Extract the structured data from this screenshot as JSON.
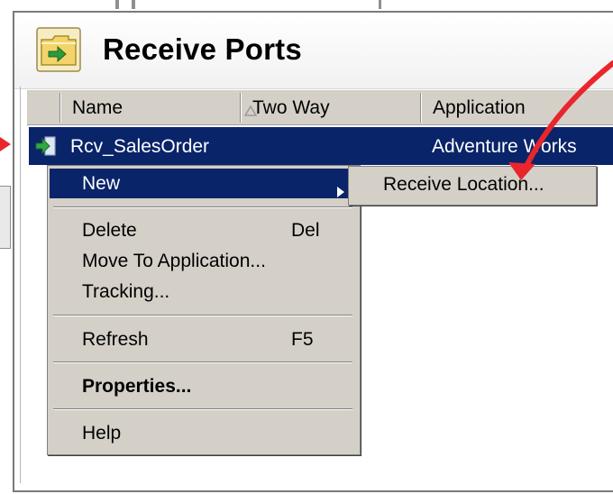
{
  "window": {
    "title": "Receive Ports"
  },
  "columns": [
    {
      "label": "Name",
      "sorted": "ascending"
    },
    {
      "label": "Two Way"
    },
    {
      "label": "Application"
    }
  ],
  "selected_row": {
    "name": "Rcv_SalesOrder",
    "two_way": "",
    "application": "Adventure Works",
    "icon": "receive-port-icon"
  },
  "context_menu": {
    "items": [
      {
        "label": "New",
        "has_submenu": true,
        "highlighted": true
      },
      {
        "label": "Delete",
        "shortcut": "Del"
      },
      {
        "label": "Move To Application..."
      },
      {
        "label": "Tracking..."
      },
      {
        "label": "Refresh",
        "shortcut": "F5"
      },
      {
        "label": "Properties...",
        "bold": true
      },
      {
        "label": "Help"
      }
    ]
  },
  "submenu": {
    "items": [
      {
        "label": "Receive Location..."
      }
    ]
  },
  "colors": {
    "selection": "#0a246a",
    "menu_bg": "#d4d0c8",
    "annotation_arrow": "#e8262c"
  },
  "icons": {
    "header": "folder-arrow-icon",
    "sort": "sort-ascending-icon",
    "submenu": "submenu-arrow-icon"
  }
}
